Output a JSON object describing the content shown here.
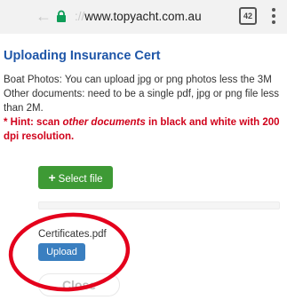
{
  "browser": {
    "back_icon": "arrow-left-icon",
    "lock_icon": "lock-icon",
    "url_scheme": "://",
    "url_host": "www.topyacht.com.au",
    "tab_count": "42",
    "menu_icon": "more-vert-icon",
    "lock_color": "#0f9d58"
  },
  "page": {
    "title": "Uploading Insurance Cert",
    "boat_photos": "Boat Photos: You can upload jpg or png photos less the 3M",
    "other_documents": "Other documents: need to be a single pdf, jpg or png file less than 2M.",
    "hint_prefix": "* Hint: scan ",
    "hint_em": "other documents",
    "hint_suffix": " in black and white with 200 dpi resolution.",
    "select_file_icon": "plus-icon",
    "select_file_label": "Select file",
    "filename": "Certificates.pdf",
    "upload_label": "Upload",
    "close_label": "Close"
  },
  "annotation": {
    "color": "#e4001c",
    "shape": "ellipse"
  },
  "colors": {
    "title": "#1e56a8",
    "hint": "#d0021b",
    "select_button": "#3e9a35",
    "upload_button": "#3a7fc0"
  }
}
